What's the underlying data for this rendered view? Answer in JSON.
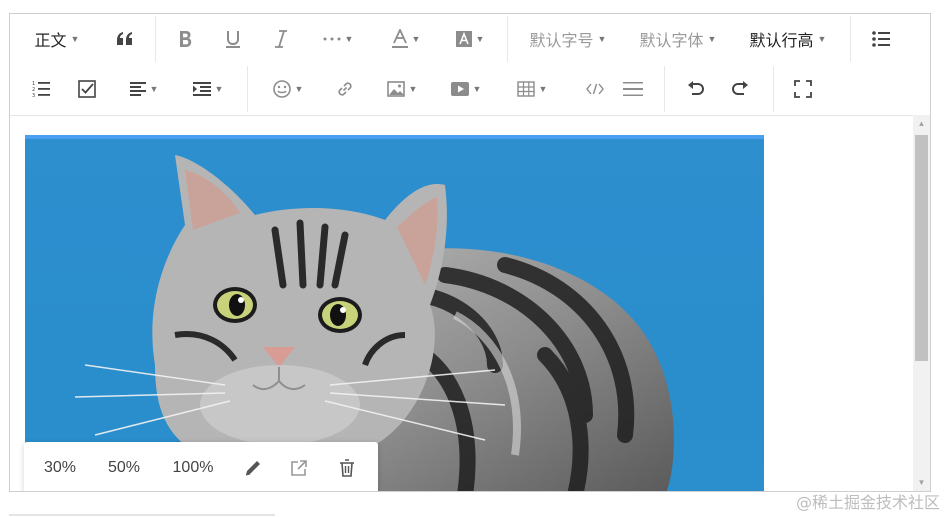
{
  "toolbar": {
    "row1": {
      "paragraph_style": "正文",
      "font_size": "默认字号",
      "font_family": "默认字体",
      "line_height": "默认行高"
    },
    "icons": [
      "blockquote-icon",
      "bold-icon",
      "underline-icon",
      "italic-icon",
      "more-icon",
      "font-color-icon",
      "background-color-icon",
      "bulleted-list-icon",
      "numbered-list-icon",
      "todo-icon",
      "align-icon",
      "indent-icon",
      "emotion-icon",
      "link-icon",
      "image-icon",
      "video-icon",
      "table-icon",
      "code-icon",
      "divider-icon",
      "undo-icon",
      "redo-icon",
      "fullscreen-icon"
    ]
  },
  "image_menu": {
    "size_30": "30%",
    "size_50": "50%",
    "size_100": "100%",
    "icons": [
      "edit-icon",
      "open-link-icon",
      "delete-icon"
    ]
  },
  "watermark": "@稀土掘金技术社区",
  "colors": {
    "photo_background": "#2b8ecd",
    "selection_bar": "#4a9ff0",
    "toolbar_icon": "#595959"
  }
}
